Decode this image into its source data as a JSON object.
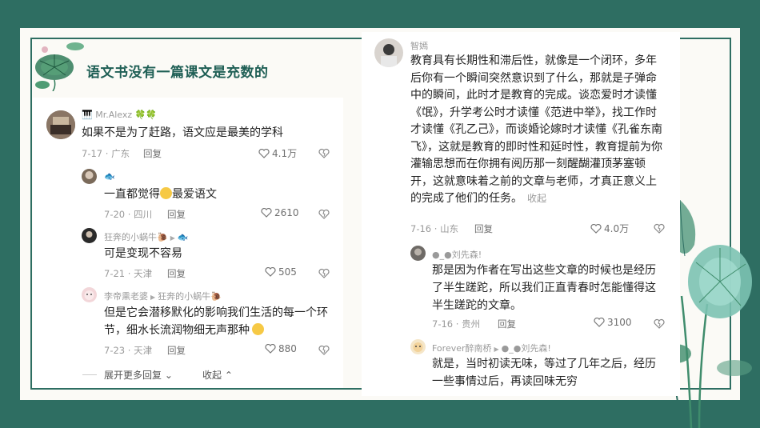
{
  "title": "语文书没有一篇课文是充数的",
  "left_comments": {
    "main": {
      "user": "Mr.Alexz",
      "text": "如果不是为了赶路，语文应是最美的学科",
      "date": "7-17",
      "place": "广东",
      "reply": "回复",
      "likes": "4.1万"
    },
    "r1": {
      "text": "一直都觉得",
      "text2": "最爱语文",
      "date": "7-20",
      "place": "四川",
      "reply": "回复",
      "likes": "2610"
    },
    "r2": {
      "user": "狂奔的小蜗牛",
      "text": "可是变现不容易",
      "date": "7-21",
      "place": "天津",
      "reply": "回复",
      "likes": "505"
    },
    "r3": {
      "user": "李帝熏老婆",
      "reply_to": "狂奔的小蜗牛",
      "text": "但是它会潜移默化的影响我们生活的每一个环节，细水长流润物细无声那种",
      "date": "7-23",
      "place": "天津",
      "reply": "回复",
      "likes": "880"
    },
    "expand": "展开更多回复",
    "collapse": "收起"
  },
  "right_comments": {
    "main": {
      "user": "智嫣",
      "text": "教育具有长期性和滞后性，就像是一个闭环，多年后你有一个瞬间突然意识到了什么，那就是子弹命中的瞬间，此时才是教育的完成。谈恋爱时才读懂《氓》，升学考公时才读懂《范进中举》，找工作时才读懂《孔乙己》，而谈婚论嫁时才读懂《孔雀东南飞》，这就是教育的即时性和延时性，教育提前为你灌输思想而在你拥有阅历那一刻醒醐灌顶茅塞顿开，这就意味着之前的文章与老师，才真正意义上的完成了他们的任务。",
      "collapse": "收起",
      "date": "7-16",
      "place": "山东",
      "reply": "回复",
      "likes": "4.0万"
    },
    "r1": {
      "user": "●_●刘先森!",
      "text": "那是因为作者在写出这些文章的时候也是经历了半生蹉跎，所以我们正直青春时怎能懂得这半生蹉跎的文章。",
      "date": "7-16",
      "place": "贵州",
      "reply": "回复",
      "likes": "3100"
    },
    "r2": {
      "user": "Forever醉南桥",
      "reply_to": "●_●刘先森!",
      "text": "就是，当时初读无味，等过了几年之后，经历一些事情过后，再读回味无穷"
    }
  },
  "colors": {
    "background": "#2e6e62",
    "accent": "#1f5f55",
    "muted": "#9a9a9a"
  }
}
